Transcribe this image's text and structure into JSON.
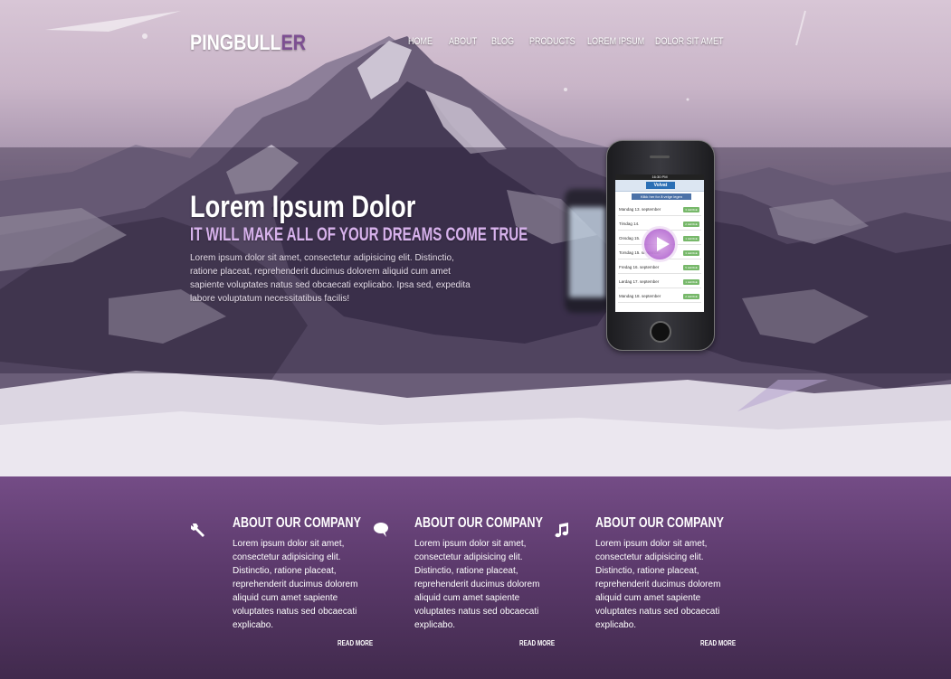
{
  "header": {
    "logo_main": "PINGBULL",
    "logo_accent": "ER",
    "nav": [
      {
        "label": "HOME",
        "active": true
      },
      {
        "label": "ABOUT"
      },
      {
        "label": "BLOG"
      },
      {
        "label": "PRODUCTS"
      },
      {
        "label": "LOREM IPSUM"
      },
      {
        "label": "DOLOR SIT AMET"
      }
    ]
  },
  "hero": {
    "title": "Lorem Ipsum Dolor",
    "subtitle": "IT WILL MAKE ALL OF YOUR DREAMS COME TRUE",
    "text": "Lorem ipsum dolor sit amet, consectetur adipisicing elit. Distinctio, ratione placeat, reprehenderit ducimus dolorem aliquid cum amet sapiente voluptates natus sed obcaecati explicabo. Ipsa sed, expedita labore voluptatum necessitatibus facilis!",
    "video_play_icon": "play-icon"
  },
  "phone_screen": {
    "time": "16:30 PM",
    "brand": "Volvat",
    "button": "Klikk her for å velge legen",
    "rows": [
      {
        "label": "Mandag 13. september",
        "tag": "3 LEDIGE"
      },
      {
        "label": "Tirsdag 14.",
        "tag": "2 LEDIGE"
      },
      {
        "label": "Onsdag 15.",
        "tag": "1 LEDIGE"
      },
      {
        "label": "Torsdag 15. september",
        "tag": "3 LEDIGE"
      },
      {
        "label": "Fredag 16. september",
        "tag": "5 LEDIGE"
      },
      {
        "label": "Lørdag 17. september",
        "tag": "1 LEDIGE"
      },
      {
        "label": "Mandag 18. september",
        "tag": "2 LEDIGE"
      }
    ]
  },
  "features": [
    {
      "icon": "wrench-icon",
      "title": "ABOUT OUR COMPANY",
      "text": "Lorem ipsum dolor sit amet, consectetur adipisicing elit. Distinctio, ratione placeat, reprehenderit ducimus dolorem aliquid cum amet sapiente voluptates natus sed obcaecati explicabo.",
      "more": "READ MORE"
    },
    {
      "icon": "speech-bubble-icon",
      "title": "ABOUT OUR COMPANY",
      "text": "Lorem ipsum dolor sit amet, consectetur adipisicing elit. Distinctio, ratione placeat, reprehenderit ducimus dolorem aliquid cum amet sapiente voluptates natus sed obcaecati explicabo.",
      "more": "READ MORE"
    },
    {
      "icon": "music-note-icon",
      "title": "ABOUT OUR COMPANY",
      "text": "Lorem ipsum dolor sit amet, consectetur adipisicing elit. Distinctio, ratione placeat, reprehenderit ducimus dolorem aliquid cum amet sapiente voluptates natus sed obcaecati explicabo.",
      "more": "READ MORE"
    }
  ],
  "colors": {
    "accent": "#7d4f92",
    "subtitle": "#d7b2ec",
    "features_bg": "#5c3a6c"
  }
}
